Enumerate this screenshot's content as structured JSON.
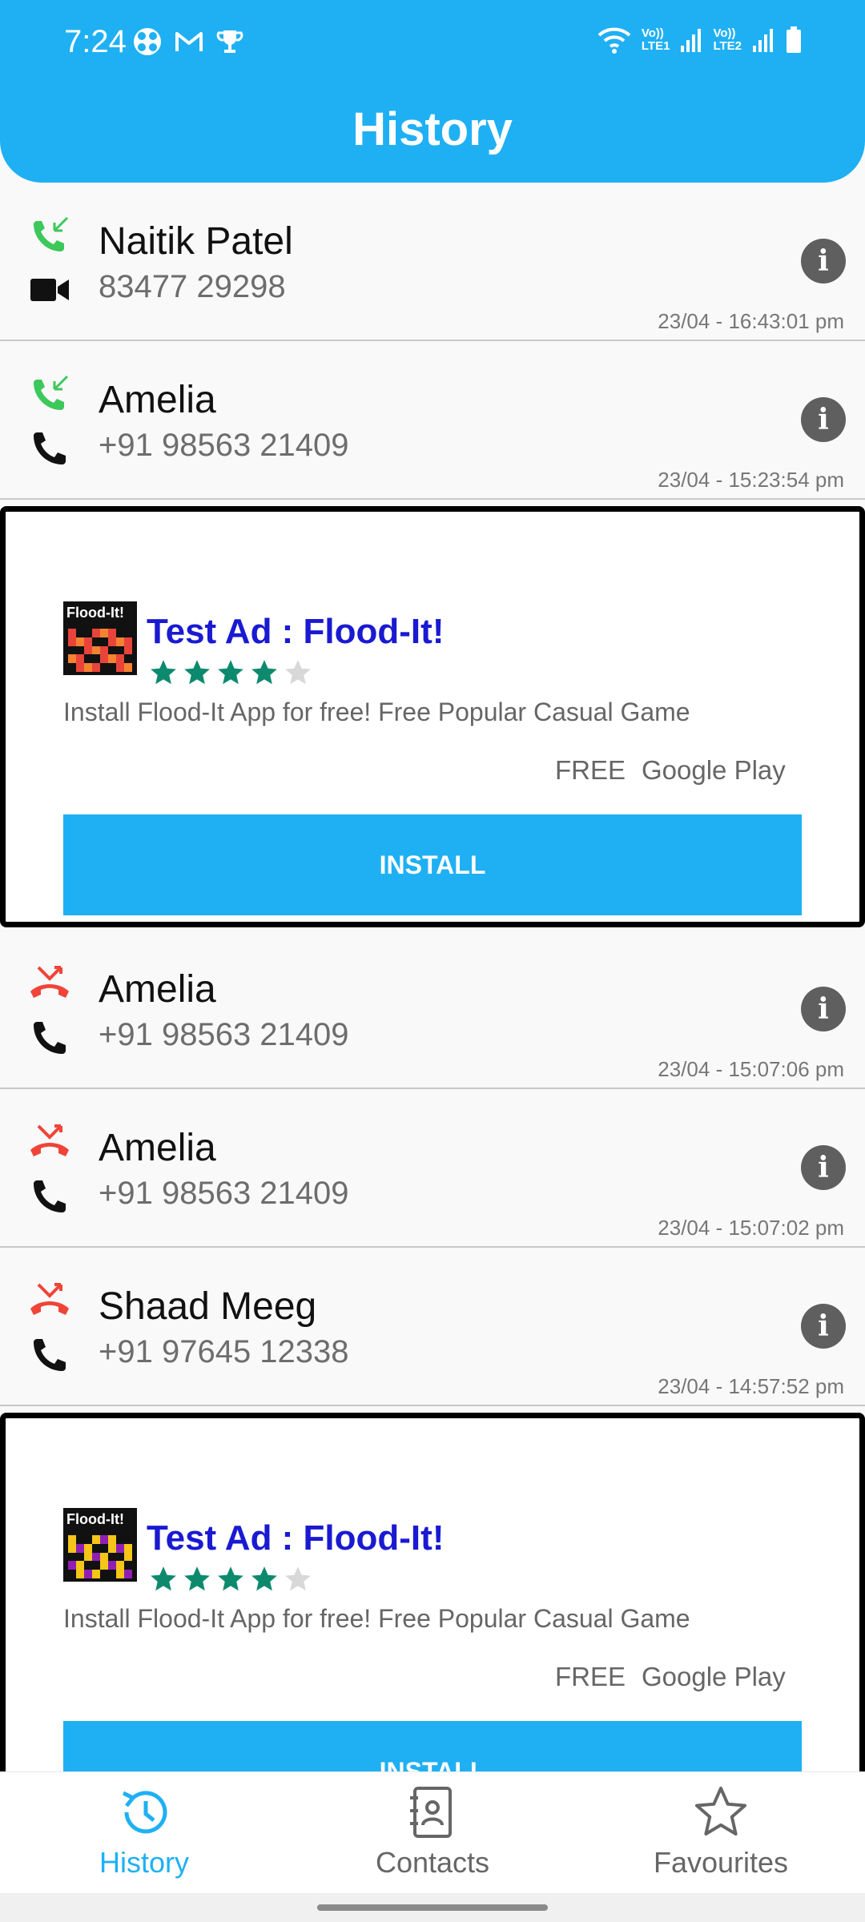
{
  "status_bar": {
    "time": "7:24",
    "sim1": "LTE1",
    "sim2": "LTE2",
    "volte": "Vo))"
  },
  "header": {
    "title": "History"
  },
  "calls_top": [
    {
      "name": "Naitik Patel",
      "number": "83477 29298",
      "timestamp": "23/04 - 16:43:01 pm",
      "type": "incoming",
      "media": "video"
    },
    {
      "name": "Amelia",
      "number": "+91 98563 21409",
      "timestamp": "23/04 - 15:23:54 pm",
      "type": "incoming",
      "media": "voice"
    }
  ],
  "ad": {
    "logo_text": "Flood-It!",
    "title": "Test Ad : Flood-It!",
    "rating": 4,
    "description": "Install Flood-It App for free! Free Popular Casual Game",
    "price": "FREE",
    "store": "Google Play",
    "cta": "INSTALL"
  },
  "calls_bottom": [
    {
      "name": "Amelia",
      "number": "+91 98563 21409",
      "timestamp": "23/04 - 15:07:06 pm",
      "type": "missed",
      "media": "voice"
    },
    {
      "name": "Amelia",
      "number": "+91 98563 21409",
      "timestamp": "23/04 - 15:07:02 pm",
      "type": "missed",
      "media": "voice"
    },
    {
      "name": "Shaad Meeg",
      "number": "+91 97645 12338",
      "timestamp": "23/04 - 14:57:52 pm",
      "type": "missed",
      "media": "voice"
    }
  ],
  "bottom_nav": [
    {
      "label": "History",
      "icon": "history-icon",
      "active": true
    },
    {
      "label": "Contacts",
      "icon": "contacts-icon",
      "active": false
    },
    {
      "label": "Favourites",
      "icon": "star-outline-icon",
      "active": false
    }
  ],
  "colors": {
    "primary": "#1fb0f3",
    "incoming": "#3cc85a",
    "missed": "#f04438",
    "ad_title": "#1a1ad2",
    "star": "#0d8a6e"
  }
}
